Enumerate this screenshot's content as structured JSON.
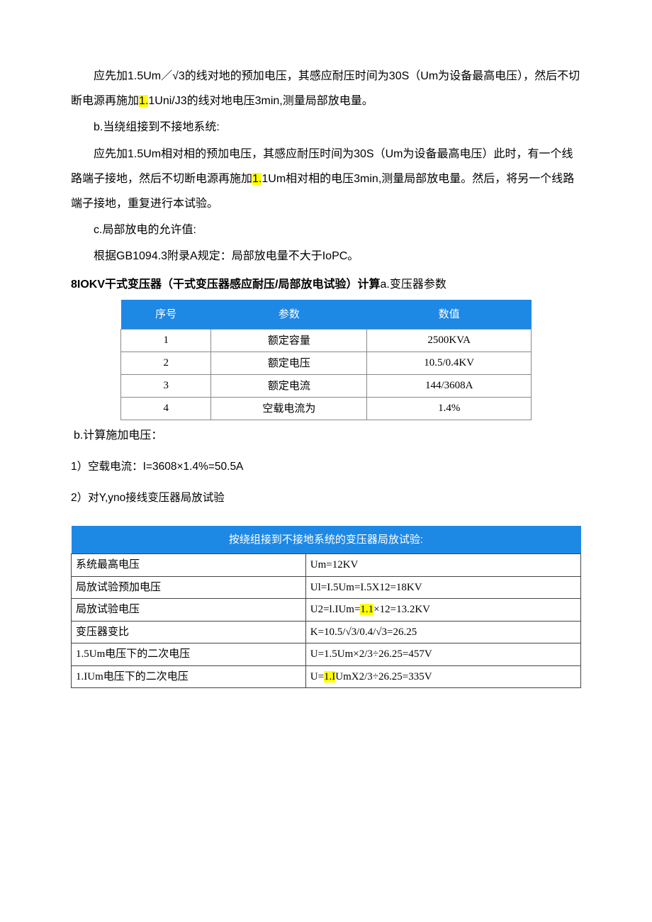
{
  "p1_a": "应先加1.5Um／√3的线对地的预加电压，其感应耐压时间为30S（Um为设备最高电压），然后不切断电源再施加",
  "p1_hl": "1.",
  "p1_b": "1Uni/J3的线对地电压3min,测量局部放电量。",
  "p2": "b.当绕组接到不接地系统:",
  "p3_a": "应先加1.5Um相对相的预加电压，其感应耐压时间为30S（Um为设备最高电压）此时，有一个线路端子接地，然后不切断电源再施加",
  "p3_hl": "1.",
  "p3_b": "1Um相对相的电压3min,测量局部放电量。然后，将另一个线路端子接地，重复进行本试验。",
  "p4": "c.局部放电的允许值:",
  "p5": "根据GB1094.3附录A规定：局部放电量不大于IoPC。",
  "sec_title_bold": "8IOKV干式变压器（干式变压器感应耐压/局部放电试验）计算",
  "sec_title_sub": "a.变压器参数",
  "table1": {
    "headers": [
      "序号",
      "参数",
      "数值"
    ],
    "rows": [
      {
        "n": "1",
        "p": "额定容量",
        "v": "2500KVA"
      },
      {
        "n": "2",
        "p": "额定电压",
        "v": "10.5/0.4KV"
      },
      {
        "n": "3",
        "p": "额定电流",
        "v": "144/3608A"
      },
      {
        "n": "4",
        "p": "空载电流为",
        "v": "1.4%"
      }
    ]
  },
  "calc_b": "b.计算施加电压：",
  "calc_1": "1）空载电流：I=3608×1.4%=50.5A",
  "calc_2": "2）对Y,yno接线变压器局放试验",
  "table2": {
    "title": "按绕组接到不接地系统的变压器局放试验:",
    "rows": [
      {
        "l": "系统最高电压",
        "v_a": "Um=12KV",
        "hl": ""
      },
      {
        "l": "局放试验预加电压",
        "v_a": "Ul=I.5Um=I.5X12=18KV",
        "hl": ""
      },
      {
        "l": "局放试验电压",
        "v_a": "U2=l.IUm=",
        "hl": "1.1",
        "v_b": "×12=13.2KV"
      },
      {
        "l": "变压器变比",
        "v_a": "K=10.5/√3/0.4/√3=26.25",
        "hl": ""
      },
      {
        "l": "1.5Um电压下的二次电压",
        "v_a": "U=1.5Um×2/3÷26.25=457V",
        "hl": ""
      },
      {
        "l": "1.IUm电压下的二次电压",
        "v_a": "U=",
        "hl": "1.I",
        "v_b": "UmX2/3÷26.25=335V"
      }
    ]
  }
}
